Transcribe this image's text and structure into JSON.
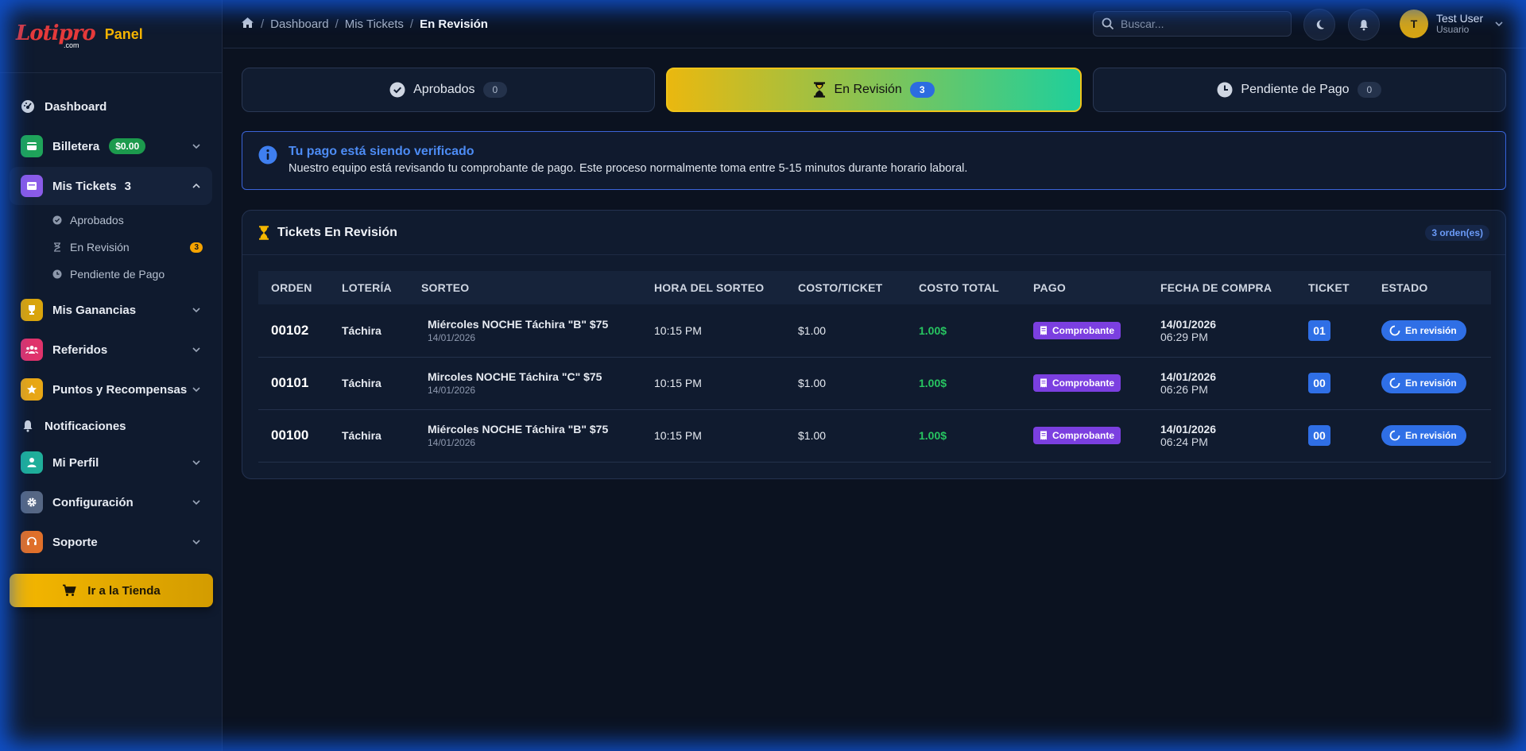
{
  "brand": {
    "logo": "Lotipro",
    "logo_sub": ".com",
    "panel": "Panel"
  },
  "sidebar": {
    "dashboard": "Dashboard",
    "wallet": {
      "label": "Billetera",
      "balance": "$0.00"
    },
    "tickets": {
      "label": "Mis Tickets",
      "count": "3",
      "sub": [
        {
          "label": "Aprobados"
        },
        {
          "label": "En Revisión",
          "badge": "3"
        },
        {
          "label": "Pendiente de Pago"
        }
      ]
    },
    "ganancias": "Mis Ganancias",
    "referidos": "Referidos",
    "puntos": "Puntos y Recompensas",
    "notificaciones": "Notificaciones",
    "perfil": "Mi Perfil",
    "config": "Configuración",
    "soporte": "Soporte",
    "store_button": "Ir a la Tienda"
  },
  "header": {
    "breadcrumb": [
      "Dashboard",
      "Mis Tickets",
      "En Revisión"
    ],
    "search_placeholder": "Buscar...",
    "user": {
      "initial": "T",
      "name": "Test User",
      "role": "Usuario"
    }
  },
  "tabs": [
    {
      "label": "Aprobados",
      "count": "0"
    },
    {
      "label": "En Revisión",
      "count": "3"
    },
    {
      "label": "Pendiente de Pago",
      "count": "0"
    }
  ],
  "info": {
    "title": "Tu pago está siendo verificado",
    "text": "Nuestro equipo está revisando tu comprobante de pago. Este proceso normalmente toma entre 5-15 minutos durante horario laboral."
  },
  "card": {
    "title": "Tickets En Revisión",
    "badge": "3 orden(es)",
    "columns": [
      "ORDEN",
      "LOTERÍA",
      "SORTEO",
      "HORA DEL SORTEO",
      "COSTO/TICKET",
      "COSTO TOTAL",
      "PAGO",
      "FECHA DE COMPRA",
      "TICKET",
      "ESTADO"
    ],
    "rows": [
      {
        "orden": "00102",
        "loteria": "Táchira",
        "sorteo": "Miércoles NOCHE Táchira \"B\" $75",
        "sorteo_fecha": "14/01/2026",
        "hora": "10:15 PM",
        "costo": "$1.00",
        "total": "1.00$",
        "pago": "Comprobante",
        "fecha": "14/01/2026",
        "hora_compra": "06:29 PM",
        "ticket": "01",
        "estado": "En revisión"
      },
      {
        "orden": "00101",
        "loteria": "Táchira",
        "sorteo": "Mircoles NOCHE Táchira \"C\" $75",
        "sorteo_fecha": "14/01/2026",
        "hora": "10:15 PM",
        "costo": "$1.00",
        "total": "1.00$",
        "pago": "Comprobante",
        "fecha": "14/01/2026",
        "hora_compra": "06:26 PM",
        "ticket": "00",
        "estado": "En revisión"
      },
      {
        "orden": "00100",
        "loteria": "Táchira",
        "sorteo": "Miércoles NOCHE Táchira \"B\" $75",
        "sorteo_fecha": "14/01/2026",
        "hora": "10:15 PM",
        "costo": "$1.00",
        "total": "1.00$",
        "pago": "Comprobante",
        "fecha": "14/01/2026",
        "hora_compra": "06:24 PM",
        "ticket": "00",
        "estado": "En revisión"
      }
    ]
  },
  "colors": {
    "accent": "#f5b700",
    "primary": "#2f6fe6",
    "success": "#27c561",
    "purple": "#7b3fe0"
  }
}
